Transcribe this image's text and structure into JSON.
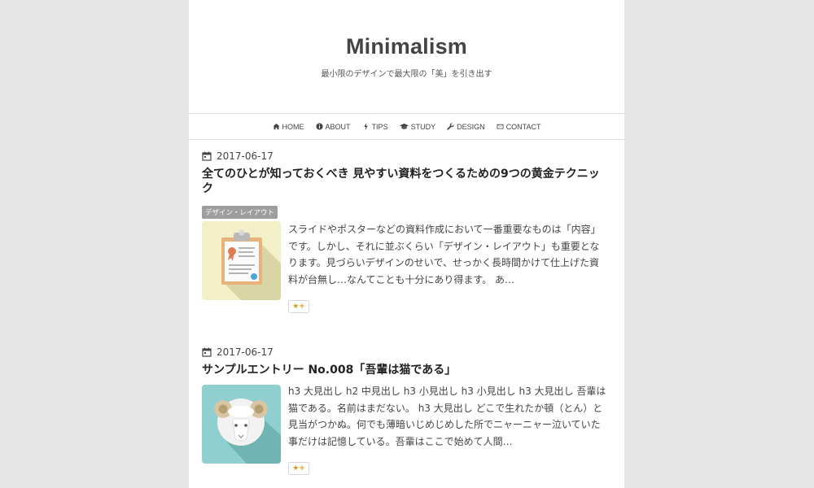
{
  "site": {
    "title": "Minimalism",
    "description": "最小限のデザインで最大限の「美」を引き出す"
  },
  "nav": [
    {
      "label": "HOME",
      "icon": "home-icon"
    },
    {
      "label": "ABOUT",
      "icon": "info-icon"
    },
    {
      "label": "TIPS",
      "icon": "bolt-icon"
    },
    {
      "label": "STUDY",
      "icon": "graduation-cap-icon"
    },
    {
      "label": "DESIGN",
      "icon": "wrench-icon"
    },
    {
      "label": "CONTACT",
      "icon": "envelope-icon"
    }
  ],
  "posts": [
    {
      "date": "2017-06-17",
      "title": "全てのひとが知っておくべき 見やすい資料をつくるための9つの黄金テクニック",
      "category": "デザイン・レイアウト",
      "excerpt": "スライドやポスターなどの資料作成において一番重要なものは「内容」です。しかし、それに並ぶくらい「デザイン・レイアウト」も重要となります。見づらいデザインのせいで、せっかく長時間かけて仕上げた資料が台無し…なんてことも十分にあり得ます。 あ…",
      "thumb_icon": "clipboard-document-icon",
      "hatena_label": "★+"
    },
    {
      "date": "2017-06-17",
      "title": "サンプルエントリー No.008「吾輩は猫である」",
      "excerpt": "h3 大見出し h2 中見出し h3 小見出し h3 小見出し h3 大見出し 吾輩は猫である。名前はまだない。 h3 大見出し どこで生れたか頓（とん）と見当がつかぬ。何でも薄暗いじめじめした所でニャーニャー泣いていた事だけは記憶している。吾輩はここで始めて人間…",
      "thumb_icon": "ram-icon",
      "hatena_label": "★+"
    }
  ],
  "colors": {
    "background": "#e6e6e6",
    "badge": "#9e9e9e",
    "hatena_star": "#d99a1c",
    "thumb1_bg": "#f3f0c9",
    "thumb2_bg": "#8fcfcf"
  }
}
